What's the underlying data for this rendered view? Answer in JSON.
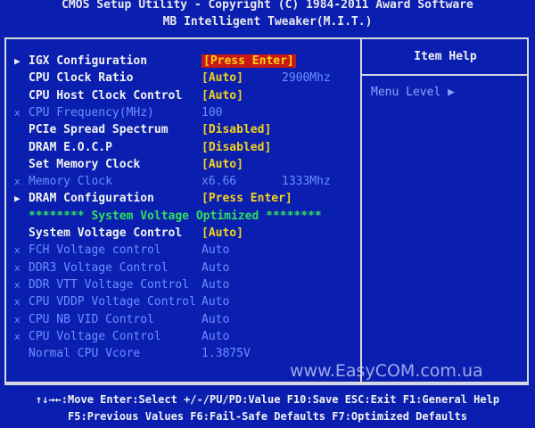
{
  "header": {
    "line1": "CMOS Setup Utility - Copyright (C) 1984-2011 Award Software",
    "line2": "MB Intelligent Tweaker(M.I.T.)"
  },
  "items": [
    {
      "marker": "▶",
      "label": "IGX Configuration",
      "value": "[Press Enter]",
      "extra": "",
      "style": "highlight"
    },
    {
      "marker": "",
      "label": "CPU Clock Ratio",
      "value": "[Auto]",
      "extra": "2900Mhz",
      "style": "normal"
    },
    {
      "marker": "",
      "label": "CPU Host Clock Control",
      "value": "[Auto]",
      "extra": "",
      "style": "normal"
    },
    {
      "marker": "x",
      "label": "CPU Frequency(MHz)",
      "value": "100",
      "extra": "",
      "style": "dim"
    },
    {
      "marker": "",
      "label": "PCIe Spread Spectrum",
      "value": "[Disabled]",
      "extra": "",
      "style": "normal"
    },
    {
      "marker": "",
      "label": "DRAM E.O.C.P",
      "value": "[Disabled]",
      "extra": "",
      "style": "normal"
    },
    {
      "marker": "",
      "label": "Set Memory Clock",
      "value": "[Auto]",
      "extra": "",
      "style": "normal"
    },
    {
      "marker": "x",
      "label": "Memory Clock",
      "value": "x6.66",
      "extra": "1333Mhz",
      "style": "dim"
    },
    {
      "marker": "▶",
      "label": "DRAM Configuration",
      "value": "[Press Enter]",
      "extra": "",
      "style": "normal"
    },
    {
      "marker": "",
      "label": "******** System Voltage Optimized ********",
      "value": "",
      "extra": "",
      "style": "banner"
    },
    {
      "marker": "",
      "label": "System Voltage Control",
      "value": "[Auto]",
      "extra": "",
      "style": "normal"
    },
    {
      "marker": "x",
      "label": "FCH Voltage control",
      "value": "Auto",
      "extra": "",
      "style": "dim"
    },
    {
      "marker": "x",
      "label": "DDR3 Voltage Control",
      "value": "Auto",
      "extra": "",
      "style": "dim"
    },
    {
      "marker": "x",
      "label": "DDR VTT Voltage Control",
      "value": "Auto",
      "extra": "",
      "style": "dim"
    },
    {
      "marker": "x",
      "label": "CPU VDDP Voltage Control",
      "value": "Auto",
      "extra": "",
      "style": "dim"
    },
    {
      "marker": "x",
      "label": "CPU NB VID Control",
      "value": "Auto",
      "extra": "",
      "style": "dim"
    },
    {
      "marker": "x",
      "label": "CPU Voltage Control",
      "value": "Auto",
      "extra": "",
      "style": "dim"
    },
    {
      "marker": "",
      "label": "Normal CPU Vcore",
      "value": "1.3875V",
      "extra": "",
      "style": "dim"
    }
  ],
  "help": {
    "title": "Item Help",
    "menu_level": "Menu Level   ▶"
  },
  "footer": {
    "line1": "↑↓→←:Move  Enter:Select  +/-/PU/PD:Value  F10:Save  ESC:Exit  F1:General Help",
    "line2": "F5:Previous Values  F6:Fail-Safe Defaults  F7:Optimized Defaults"
  },
  "watermark": "www.EasyCOM.com.ua",
  "colors": {
    "background": "#0a1fb0",
    "value_yellow": "#f4d21a",
    "highlight_red": "#c81818",
    "dim_blue": "#6f8cff",
    "banner_green": "#2ee25c"
  }
}
